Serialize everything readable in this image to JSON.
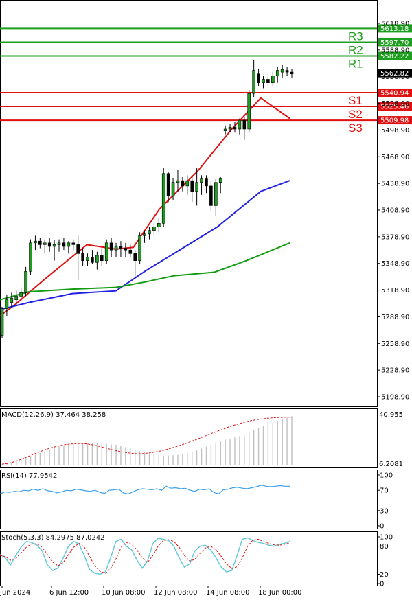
{
  "chart_data": {
    "type": "candlestick",
    "price_axis": {
      "ticks": [
        "5618.90",
        "5588.90",
        "5558.90",
        "5528.90",
        "5498.90",
        "5468.90",
        "5438.90",
        "5408.90",
        "5378.90",
        "5348.90",
        "5318.90",
        "5288.90",
        "5258.90",
        "5228.90",
        "5198.90"
      ],
      "ylim": [
        5190,
        5628
      ]
    },
    "time_axis": [
      "Jun 2024",
      "6 Jun 12:00",
      "10 Jun 08:00",
      "12 Jun 08:00",
      "14 Jun 08:00",
      "18 Jun 00:00"
    ],
    "current_price": {
      "value": 5562.82,
      "label": "5562.82"
    },
    "levels": [
      {
        "name": "R3",
        "value": 5613.18,
        "label": "5613.18",
        "color": "#1e9e1e"
      },
      {
        "name": "R2",
        "value": 5597.7,
        "label": "5597.70",
        "color": "#1e9e1e"
      },
      {
        "name": "R1",
        "value": 5582.22,
        "label": "5582.22",
        "color": "#1e9e1e"
      },
      {
        "name": "S1",
        "value": 5540.94,
        "label": "5540.94",
        "color": "#e01010"
      },
      {
        "name": "S2",
        "value": 5525.46,
        "label": "5525.46",
        "color": "#e01010"
      },
      {
        "name": "S3",
        "value": 5509.98,
        "label": "5509.98",
        "color": "#e01010"
      }
    ],
    "candles": [
      [
        5268,
        5300,
        5265,
        5298
      ],
      [
        5298,
        5314,
        5290,
        5308
      ],
      [
        5305,
        5316,
        5300,
        5310
      ],
      [
        5308,
        5318,
        5302,
        5312
      ],
      [
        5312,
        5322,
        5306,
        5316
      ],
      [
        5316,
        5345,
        5312,
        5340
      ],
      [
        5340,
        5376,
        5336,
        5372
      ],
      [
        5372,
        5380,
        5364,
        5374
      ],
      [
        5374,
        5378,
        5366,
        5370
      ],
      [
        5370,
        5376,
        5360,
        5372
      ],
      [
        5372,
        5378,
        5362,
        5368
      ],
      [
        5368,
        5375,
        5352,
        5370
      ],
      [
        5370,
        5376,
        5362,
        5372
      ],
      [
        5372,
        5378,
        5364,
        5368
      ],
      [
        5368,
        5374,
        5360,
        5372
      ],
      [
        5372,
        5376,
        5364,
        5370
      ],
      [
        5370,
        5380,
        5330,
        5360
      ],
      [
        5360,
        5366,
        5346,
        5352
      ],
      [
        5352,
        5360,
        5346,
        5356
      ],
      [
        5356,
        5364,
        5348,
        5350
      ],
      [
        5350,
        5362,
        5342,
        5358
      ],
      [
        5358,
        5366,
        5346,
        5352
      ],
      [
        5352,
        5376,
        5348,
        5372
      ],
      [
        5372,
        5378,
        5356,
        5364
      ],
      [
        5364,
        5372,
        5356,
        5368
      ],
      [
        5368,
        5374,
        5356,
        5366
      ],
      [
        5366,
        5372,
        5356,
        5364
      ],
      [
        5364,
        5370,
        5356,
        5360
      ],
      [
        5360,
        5364,
        5332,
        5352
      ],
      [
        5352,
        5384,
        5348,
        5380
      ],
      [
        5380,
        5386,
        5372,
        5382
      ],
      [
        5382,
        5390,
        5376,
        5386
      ],
      [
        5386,
        5394,
        5380,
        5390
      ],
      [
        5390,
        5400,
        5384,
        5394
      ],
      [
        5394,
        5456,
        5390,
        5450
      ],
      [
        5450,
        5452,
        5418,
        5425
      ],
      [
        5425,
        5445,
        5420,
        5440
      ],
      [
        5440,
        5454,
        5430,
        5442
      ],
      [
        5442,
        5446,
        5430,
        5436
      ],
      [
        5436,
        5448,
        5426,
        5442
      ],
      [
        5442,
        5448,
        5418,
        5430
      ],
      [
        5430,
        5456,
        5414,
        5440
      ],
      [
        5440,
        5448,
        5426,
        5444
      ],
      [
        5444,
        5448,
        5428,
        5436
      ],
      [
        5436,
        5442,
        5408,
        5414
      ],
      [
        5414,
        5444,
        5402,
        5440
      ],
      [
        5440,
        5446,
        5428,
        5444
      ],
      [
        5498,
        5504,
        5494,
        5500
      ],
      [
        5500,
        5506,
        5496,
        5502
      ],
      [
        5502,
        5508,
        5496,
        5500
      ],
      [
        5500,
        5512,
        5494,
        5510
      ],
      [
        5510,
        5514,
        5488,
        5500
      ],
      [
        5500,
        5544,
        5496,
        5540
      ],
      [
        5540,
        5578,
        5536,
        5566
      ],
      [
        5562,
        5568,
        5548,
        5552
      ],
      [
        5552,
        5560,
        5546,
        5556
      ],
      [
        5556,
        5562,
        5548,
        5552
      ],
      [
        5552,
        5564,
        5548,
        5560
      ],
      [
        5560,
        5570,
        5552,
        5566
      ],
      [
        5564,
        5572,
        5558,
        5567
      ],
      [
        5566,
        5570,
        5560,
        5564
      ],
      [
        5564,
        5568,
        5558,
        5562
      ]
    ],
    "moving_averages": [
      {
        "color": "#e01010",
        "x": [
          0,
          0.05,
          0.15,
          0.3,
          0.4,
          0.46,
          0.55,
          0.68,
          0.8,
          0.9,
          1
        ],
        "values": [
          5290,
          5302,
          5330,
          5370,
          5365,
          5367,
          5410,
          5452,
          5500,
          5535,
          5512
        ]
      },
      {
        "color": "#2020e0",
        "x": [
          0,
          0.1,
          0.25,
          0.4,
          0.5,
          0.6,
          0.75,
          0.9,
          1
        ],
        "values": [
          5297,
          5305,
          5315,
          5318,
          5340,
          5360,
          5390,
          5430,
          5442
        ]
      },
      {
        "color": "#129c12",
        "x": [
          0,
          0.1,
          0.25,
          0.4,
          0.5,
          0.6,
          0.74,
          0.85,
          1
        ],
        "values": [
          5308,
          5317,
          5320,
          5322,
          5328,
          5335,
          5339,
          5352,
          5372
        ]
      }
    ],
    "macd": {
      "label": "MACD(12,26,9) 37.464 38.258",
      "ticks": [
        "40.955",
        "6.2081"
      ],
      "histogram": [
        0.5,
        1.2,
        2.2,
        3.2,
        4.5,
        5.8,
        7,
        8,
        9.5,
        10.5,
        12,
        13.5,
        14.6,
        15.5,
        16,
        16.6,
        17,
        17.4,
        17.5,
        17.4,
        17.2,
        17,
        16.8,
        16.4,
        16,
        15.2,
        14.2,
        13.2,
        12,
        11,
        10,
        9,
        8.2,
        7.6,
        7.4,
        7.4,
        7.6,
        8,
        8.6,
        9,
        10,
        11.5,
        13,
        14.6,
        16.2,
        17.8,
        19,
        20.2,
        21,
        22,
        23,
        24,
        26,
        28,
        29.6,
        31,
        32.6,
        34,
        35.4,
        36.8,
        38,
        39
      ],
      "signal": [
        0.5,
        1,
        2,
        3.5,
        5,
        6.8,
        8.5,
        10.2,
        11.8,
        13.2,
        14.4,
        15.4,
        16.2,
        16.7,
        17,
        17.1,
        16.8,
        16.2,
        15.3,
        14.3,
        13.1,
        12,
        11,
        10.2,
        9.5,
        9,
        8.8,
        9,
        9.5,
        10.2,
        11,
        12,
        13.2,
        14.5,
        15.9,
        17.4,
        19,
        20.6,
        22.2,
        24,
        25.6,
        27.2,
        28.8,
        30.4,
        31.8,
        33.1,
        34.3,
        35.3,
        36.1,
        36.8,
        37.3,
        37.7,
        38,
        38.2,
        38.3,
        38.3
      ]
    },
    "rsi": {
      "label": "RSI(14) 77.9542",
      "ticks": [
        "100",
        "70",
        "30",
        "0"
      ],
      "values": [
        63,
        67,
        66,
        68,
        67,
        70,
        69,
        72,
        70,
        73,
        69,
        68,
        65,
        67,
        70,
        69,
        72,
        71,
        69,
        68,
        70,
        66,
        64,
        70,
        71,
        72,
        65,
        63,
        67,
        71,
        73,
        72,
        71,
        73,
        70,
        78,
        74,
        75,
        73,
        74,
        70,
        68,
        72,
        71,
        73,
        66,
        63,
        71,
        72,
        75,
        76,
        74,
        73,
        75,
        77,
        80,
        78,
        77,
        78,
        79,
        78,
        78
      ]
    },
    "stoch": {
      "label": "Stoch(5,3,3) 84.2975 87.0242",
      "ticks": [
        "100",
        "80",
        "20",
        "0"
      ],
      "k": [
        62,
        55,
        40,
        60,
        78,
        90,
        88,
        82,
        70,
        40,
        28,
        33,
        55,
        80,
        90,
        85,
        60,
        30,
        22,
        20,
        25,
        55,
        90,
        95,
        80,
        72,
        50,
        33,
        48,
        85,
        97,
        95,
        92,
        80,
        55,
        35,
        42,
        70,
        80,
        82,
        72,
        55,
        35,
        25,
        28,
        60,
        95,
        98,
        92,
        88,
        86,
        82,
        80,
        84,
        86,
        90
      ],
      "d": [
        60,
        58,
        50,
        54,
        65,
        78,
        85,
        85,
        78,
        62,
        46,
        38,
        45,
        62,
        78,
        86,
        78,
        58,
        38,
        26,
        22,
        32,
        52,
        78,
        88,
        84,
        72,
        55,
        45,
        60,
        80,
        92,
        94,
        90,
        78,
        60,
        48,
        52,
        65,
        76,
        80,
        72,
        58,
        42,
        32,
        36,
        55,
        80,
        93,
        95,
        90,
        86,
        83,
        82,
        84,
        87
      ]
    }
  }
}
